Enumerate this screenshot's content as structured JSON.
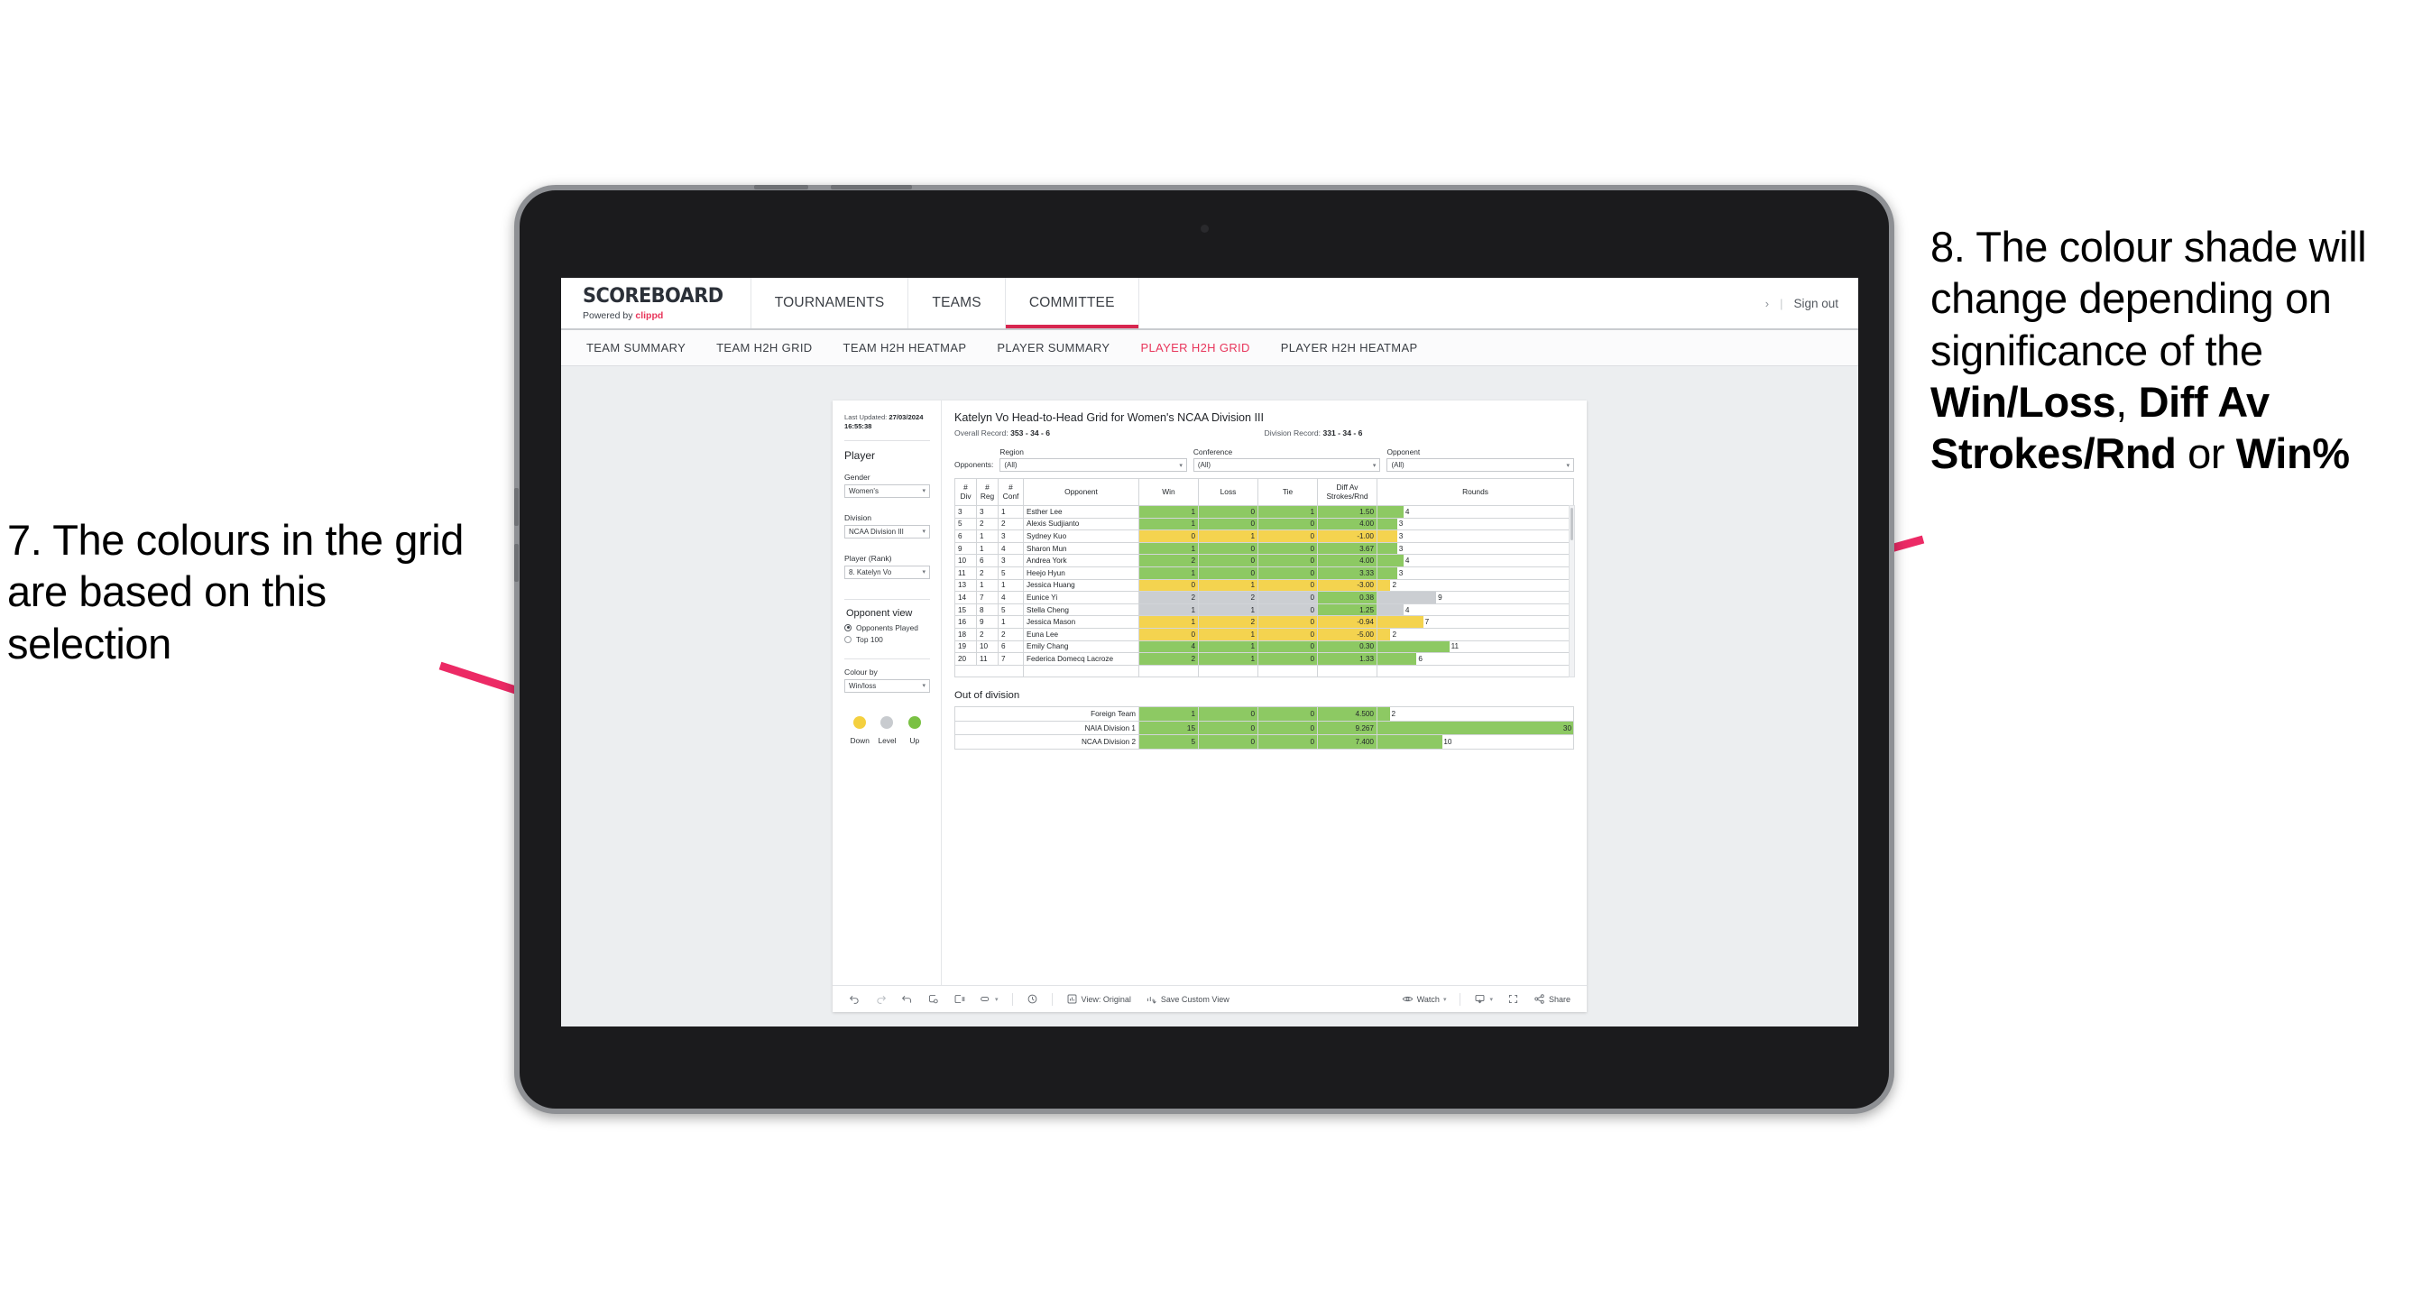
{
  "annotations": {
    "left": "7. The colours in the grid are based on this selection",
    "right_plain_1": "8. The colour shade will change depending on significance of the ",
    "right_bold_1": "Win/Loss",
    "right_plain_2": ", ",
    "right_bold_2": "Diff Av Strokes/Rnd",
    "right_plain_3": " or ",
    "right_bold_3": "Win%"
  },
  "app": {
    "brand_title": "SCOREBOARD",
    "brand_sub_prefix": "Powered by ",
    "brand_sub_name": "clippd",
    "top_nav": [
      {
        "label": "TOURNAMENTS",
        "active": false
      },
      {
        "label": "TEAMS",
        "active": false
      },
      {
        "label": "COMMITTEE",
        "active": true
      }
    ],
    "top_right": {
      "chevron": "›",
      "divider": "|",
      "sign_out": "Sign out"
    },
    "sub_nav": [
      {
        "label": "TEAM SUMMARY",
        "active": false
      },
      {
        "label": "TEAM H2H GRID",
        "active": false
      },
      {
        "label": "TEAM H2H HEATMAP",
        "active": false
      },
      {
        "label": "PLAYER SUMMARY",
        "active": false
      },
      {
        "label": "PLAYER H2H GRID",
        "active": true
      },
      {
        "label": "PLAYER H2H HEATMAP",
        "active": false
      }
    ]
  },
  "panel": {
    "last_updated_label": "Last Updated: ",
    "last_updated_value": "27/03/2024 16:55:38",
    "section_title": "Player",
    "gender_label": "Gender",
    "gender_value": "Women's",
    "division_label": "Division",
    "division_value": "NCAA Division III",
    "player_label": "Player (Rank)",
    "player_value": "8. Katelyn Vo",
    "opponent_view_title": "Opponent view",
    "opponent_options": [
      {
        "label": "Opponents Played",
        "selected": true
      },
      {
        "label": "Top 100",
        "selected": false
      }
    ],
    "colour_by_label": "Colour by",
    "colour_by_value": "Win/loss",
    "legend": [
      {
        "label": "Down",
        "color": "#f4d03f"
      },
      {
        "label": "Level",
        "color": "#c8cbcf"
      },
      {
        "label": "Up",
        "color": "#7ac143"
      }
    ]
  },
  "main": {
    "title": "Katelyn Vo Head-to-Head Grid for Women's NCAA Division III",
    "overall_record_label": "Overall Record: ",
    "overall_record_value": "353 -  34 - 6",
    "division_record_label": "Division Record: ",
    "division_record_value": "331 -  34 - 6",
    "opponents_label": "Opponents:",
    "filters": [
      {
        "label": "Region",
        "value": "(All)"
      },
      {
        "label": "Conference",
        "value": "(All)"
      },
      {
        "label": "Opponent",
        "value": "(All)"
      }
    ],
    "out_of_division_title": "Out of division"
  },
  "chart_data": {
    "type": "table",
    "title": "Katelyn Vo Head-to-Head Grid for Women's NCAA Division III",
    "columns": [
      "# Div",
      "# Reg",
      "# Conf",
      "Opponent",
      "Win",
      "Loss",
      "Tie",
      "Diff Av Strokes/Rnd",
      "Rounds"
    ],
    "column_headers_two_line": [
      {
        "top": "#",
        "bottom": "Div"
      },
      {
        "top": "#",
        "bottom": "Reg"
      },
      {
        "top": "#",
        "bottom": "Conf"
      },
      {
        "top": "Opponent",
        "bottom": ""
      },
      {
        "top": "Win",
        "bottom": ""
      },
      {
        "top": "Loss",
        "bottom": ""
      },
      {
        "top": "Tie",
        "bottom": ""
      },
      {
        "top": "Diff Av",
        "bottom": "Strokes/Rnd"
      },
      {
        "top": "Rounds",
        "bottom": ""
      }
    ],
    "rounds_max": 30,
    "rows": [
      {
        "div": "3",
        "reg": "3",
        "conf": "1",
        "opponent": "Esther Lee",
        "win": "1",
        "loss": "0",
        "tie": "1",
        "diff": "1.50",
        "rounds": 4,
        "color": "#8dc963",
        "rounds_color": "#8dc963"
      },
      {
        "div": "5",
        "reg": "2",
        "conf": "2",
        "opponent": "Alexis Sudjianto",
        "win": "1",
        "loss": "0",
        "tie": "0",
        "diff": "4.00",
        "rounds": 3,
        "color": "#8dc963",
        "rounds_color": "#8dc963"
      },
      {
        "div": "6",
        "reg": "1",
        "conf": "3",
        "opponent": "Sydney Kuo",
        "win": "0",
        "loss": "1",
        "tie": "0",
        "diff": "-1.00",
        "rounds": 3,
        "color": "#f4d34f",
        "rounds_color": "#f4d34f"
      },
      {
        "div": "9",
        "reg": "1",
        "conf": "4",
        "opponent": "Sharon Mun",
        "win": "1",
        "loss": "0",
        "tie": "0",
        "diff": "3.67",
        "rounds": 3,
        "color": "#8dc963",
        "rounds_color": "#8dc963"
      },
      {
        "div": "10",
        "reg": "6",
        "conf": "3",
        "opponent": "Andrea York",
        "win": "2",
        "loss": "0",
        "tie": "0",
        "diff": "4.00",
        "rounds": 4,
        "color": "#8dc963",
        "rounds_color": "#8dc963"
      },
      {
        "div": "11",
        "reg": "2",
        "conf": "5",
        "opponent": "Heejo Hyun",
        "win": "1",
        "loss": "0",
        "tie": "0",
        "diff": "3.33",
        "rounds": 3,
        "color": "#8dc963",
        "rounds_color": "#8dc963"
      },
      {
        "div": "13",
        "reg": "1",
        "conf": "1",
        "opponent": "Jessica Huang",
        "win": "0",
        "loss": "1",
        "tie": "0",
        "diff": "-3.00",
        "rounds": 2,
        "color": "#f4d34f",
        "rounds_color": "#f4d34f"
      },
      {
        "div": "14",
        "reg": "7",
        "conf": "4",
        "opponent": "Eunice Yi",
        "win": "2",
        "loss": "2",
        "tie": "0",
        "diff": "0.38",
        "rounds": 9,
        "color": "#cbced2",
        "diff_color": "#8dc963",
        "rounds_color": "#cbced2"
      },
      {
        "div": "15",
        "reg": "8",
        "conf": "5",
        "opponent": "Stella Cheng",
        "win": "1",
        "loss": "1",
        "tie": "0",
        "diff": "1.25",
        "rounds": 4,
        "color": "#cbced2",
        "diff_color": "#8dc963",
        "rounds_color": "#cbced2"
      },
      {
        "div": "16",
        "reg": "9",
        "conf": "1",
        "opponent": "Jessica Mason",
        "win": "1",
        "loss": "2",
        "tie": "0",
        "diff": "-0.94",
        "rounds": 7,
        "color": "#f4d34f",
        "rounds_color": "#f4d34f"
      },
      {
        "div": "18",
        "reg": "2",
        "conf": "2",
        "opponent": "Euna Lee",
        "win": "0",
        "loss": "1",
        "tie": "0",
        "diff": "-5.00",
        "rounds": 2,
        "color": "#f4d34f",
        "rounds_color": "#f4d34f"
      },
      {
        "div": "19",
        "reg": "10",
        "conf": "6",
        "opponent": "Emily Chang",
        "win": "4",
        "loss": "1",
        "tie": "0",
        "diff": "0.30",
        "rounds": 11,
        "color": "#8dc963",
        "rounds_color": "#8dc963"
      },
      {
        "div": "20",
        "reg": "11",
        "conf": "7",
        "opponent": "Federica Domecq Lacroze",
        "win": "2",
        "loss": "1",
        "tie": "0",
        "diff": "1.33",
        "rounds": 6,
        "color": "#8dc963",
        "rounds_color": "#8dc963"
      }
    ],
    "out_of_division": {
      "title": "Out of division",
      "rounds_max": 30,
      "rows": [
        {
          "name": "Foreign Team",
          "win": "1",
          "loss": "0",
          "tie": "0",
          "diff": "4.500",
          "rounds": 2,
          "color": "#8dc963",
          "rounds_color": "#8dc963"
        },
        {
          "name": "NAIA Division 1",
          "win": "15",
          "loss": "0",
          "tie": "0",
          "diff": "9.267",
          "rounds": 30,
          "color": "#8dc963",
          "rounds_color": "#8dc963"
        },
        {
          "name": "NCAA Division 2",
          "win": "5",
          "loss": "0",
          "tie": "0",
          "diff": "7.400",
          "rounds": 10,
          "color": "#8dc963",
          "rounds_color": "#8dc963"
        }
      ]
    }
  },
  "toolbar": {
    "icons": [
      "undo-icon",
      "redo-icon",
      "revert-icon",
      "refresh-icon",
      "pause-icon",
      "highlight-icon"
    ],
    "view_label": "View: Original",
    "save_label": "Save Custom View",
    "watch_label": "Watch",
    "share_label": "Share"
  },
  "colors": {
    "accent": "#e8365c",
    "up": "#7ac143",
    "down": "#f4d03f",
    "level": "#c8cbcf",
    "arrow": "#ec2a65"
  }
}
